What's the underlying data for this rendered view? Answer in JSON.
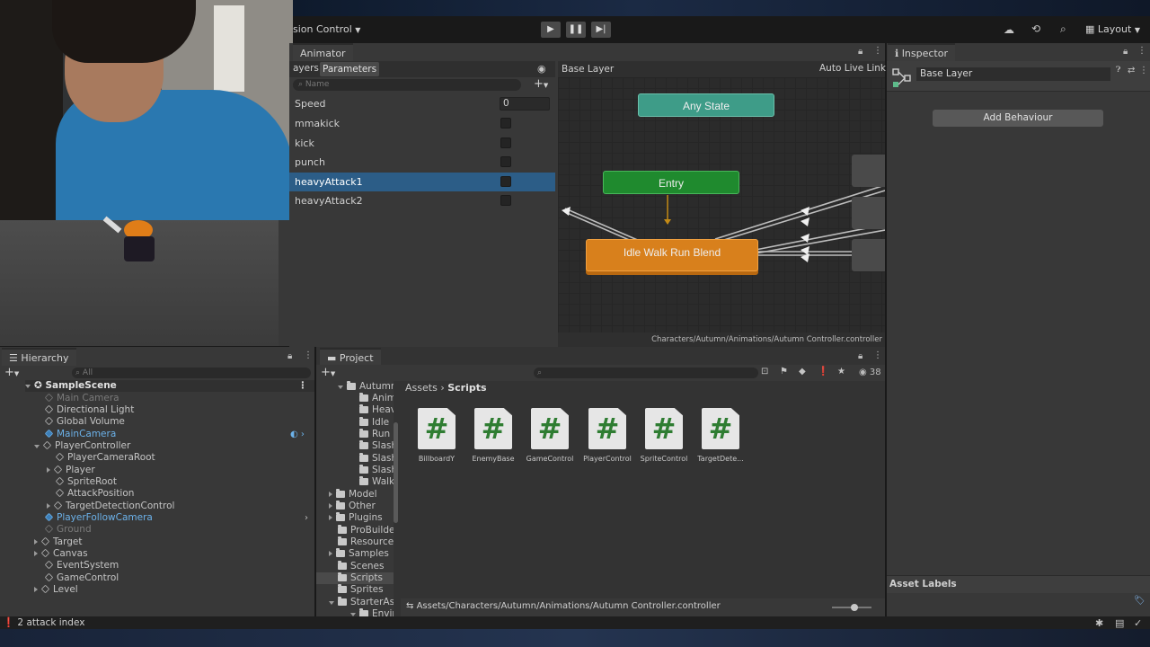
{
  "toolbar": {
    "version_control": "sion Control",
    "layout_label": "Layout"
  },
  "animator": {
    "tab_label": "Animator",
    "subtab_layers": "ayers",
    "subtab_parameters": "Parameters",
    "search_placeholder": "Name",
    "breadcrumb": "Base Layer",
    "auto_live_link": "Auto Live Link",
    "path": "Characters/Autumn/Animations/Autumn Controller.controller",
    "parameters": [
      {
        "name": "Speed",
        "value": "0"
      },
      {
        "name": "mmakick"
      },
      {
        "name": "kick"
      },
      {
        "name": "punch"
      },
      {
        "name": "heavyAttack1"
      },
      {
        "name": "heavyAttack2"
      }
    ],
    "nodes": {
      "any_state": "Any State",
      "entry": "Entry",
      "idle": "Idle Walk Run Blend"
    },
    "colors": {
      "any_state": "#3e9c88",
      "entry": "#1f8a2e",
      "idle": "#d8801c",
      "selection": "#2c5d87"
    }
  },
  "inspector": {
    "tab_label": "Inspector",
    "name_field": "Base Layer",
    "add_behaviour": "Add Behaviour",
    "asset_labels": "Asset Labels"
  },
  "hierarchy": {
    "tab_label": "Hierarchy",
    "search_placeholder": "All",
    "scene": "SampleScene",
    "items": [
      {
        "label": "Main Camera"
      },
      {
        "label": "Directional Light"
      },
      {
        "label": "Global Volume"
      },
      {
        "label": "MainCamera"
      },
      {
        "label": "PlayerController"
      },
      {
        "label": "PlayerCameraRoot"
      },
      {
        "label": "Player"
      },
      {
        "label": "SpriteRoot"
      },
      {
        "label": "AttackPosition"
      },
      {
        "label": "TargetDetectionControl"
      },
      {
        "label": "PlayerFollowCamera"
      },
      {
        "label": "Ground"
      },
      {
        "label": "Target"
      },
      {
        "label": "Canvas"
      },
      {
        "label": "EventSystem"
      },
      {
        "label": "GameControl"
      },
      {
        "label": "Level"
      }
    ]
  },
  "project": {
    "tab_label": "Project",
    "hidden_count": "38",
    "breadcrumb_root": "Assets",
    "breadcrumb_current": "Scripts",
    "tree": [
      {
        "label": "Autumr"
      },
      {
        "label": "Anim"
      },
      {
        "label": "Heav"
      },
      {
        "label": "Idle"
      },
      {
        "label": "Run"
      },
      {
        "label": "Slash"
      },
      {
        "label": "Slash"
      },
      {
        "label": "Slash"
      },
      {
        "label": "Walk"
      },
      {
        "label": "Model"
      },
      {
        "label": "Other"
      },
      {
        "label": "Plugins"
      },
      {
        "label": "ProBuilde"
      },
      {
        "label": "Resource"
      },
      {
        "label": "Samples"
      },
      {
        "label": "Scenes"
      },
      {
        "label": "Scripts"
      },
      {
        "label": "Sprites"
      },
      {
        "label": "StarterAs"
      },
      {
        "label": "Environ"
      }
    ],
    "scripts": [
      {
        "glyph": "#",
        "label": "BillboardY"
      },
      {
        "glyph": "#",
        "label": "EnemyBase"
      },
      {
        "glyph": "#",
        "label": "GameControl"
      },
      {
        "glyph": "#",
        "label": "PlayerControl"
      },
      {
        "glyph": "#",
        "label": "SpriteControl"
      },
      {
        "glyph": "#",
        "label": "TargetDete..."
      }
    ],
    "footer_path": "Assets/Characters/Autumn/Animations/Autumn Controller.controller"
  },
  "status_bar": {
    "message": "2 attack index"
  }
}
